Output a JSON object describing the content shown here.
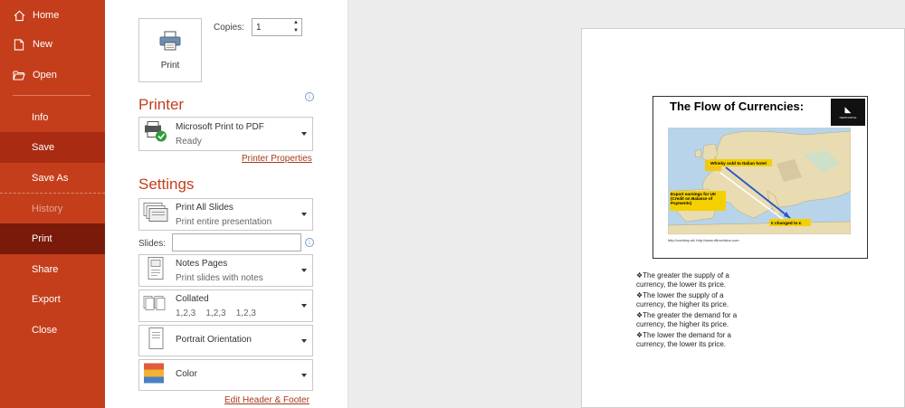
{
  "sidebar": {
    "items": [
      {
        "label": "Home",
        "icon": "home-icon"
      },
      {
        "label": "New",
        "icon": "new-document-icon"
      },
      {
        "label": "Open",
        "icon": "folder-open-icon"
      },
      {
        "label": "Info"
      },
      {
        "label": "Save"
      },
      {
        "label": "Save As"
      },
      {
        "label": "History"
      },
      {
        "label": "Print"
      },
      {
        "label": "Share"
      },
      {
        "label": "Export"
      },
      {
        "label": "Close"
      }
    ],
    "active": "Print",
    "colors": {
      "background": "#c43e1c",
      "active": "#7a1a0a",
      "hover": "#a92b12"
    }
  },
  "print": {
    "button_label": "Print",
    "copies_label": "Copies:",
    "copies_value": "1"
  },
  "printer": {
    "heading": "Printer",
    "name": "Microsoft Print to PDF",
    "status": "Ready",
    "properties_link": "Printer Properties"
  },
  "settings": {
    "heading": "Settings",
    "range": {
      "title": "Print All Slides",
      "subtitle": "Print entire presentation"
    },
    "slides_label": "Slides:",
    "slides_value": "",
    "layout": {
      "title": "Notes Pages",
      "subtitle": "Print slides with notes"
    },
    "collation": {
      "title": "Collated",
      "subtitle": "1,2,3    1,2,3    1,2,3"
    },
    "orientation": {
      "title": "Portrait Orientation"
    },
    "color": {
      "title": "Color"
    },
    "header_footer_link": "Edit Header & Footer"
  },
  "preview": {
    "slide_title": "The Flow of Currencies:",
    "logo_text": "NEWCASTLE",
    "map_labels": {
      "whisky": "Whisky sold to Italian hotel",
      "export": "Export earnings for UK (Credit on Balance of Payments)",
      "changed": "€ changed to £"
    },
    "credit": "http://contboy.uk/  http://www.r8lovelslon.com",
    "notes": [
      "❖The greater the supply of a currency, the lower its price.",
      "❖The lower the supply of a currency, the higher its price.",
      "❖The greater the demand for a currency, the higher its price.",
      "❖The lower the demand for a currency, the lower its price."
    ]
  }
}
